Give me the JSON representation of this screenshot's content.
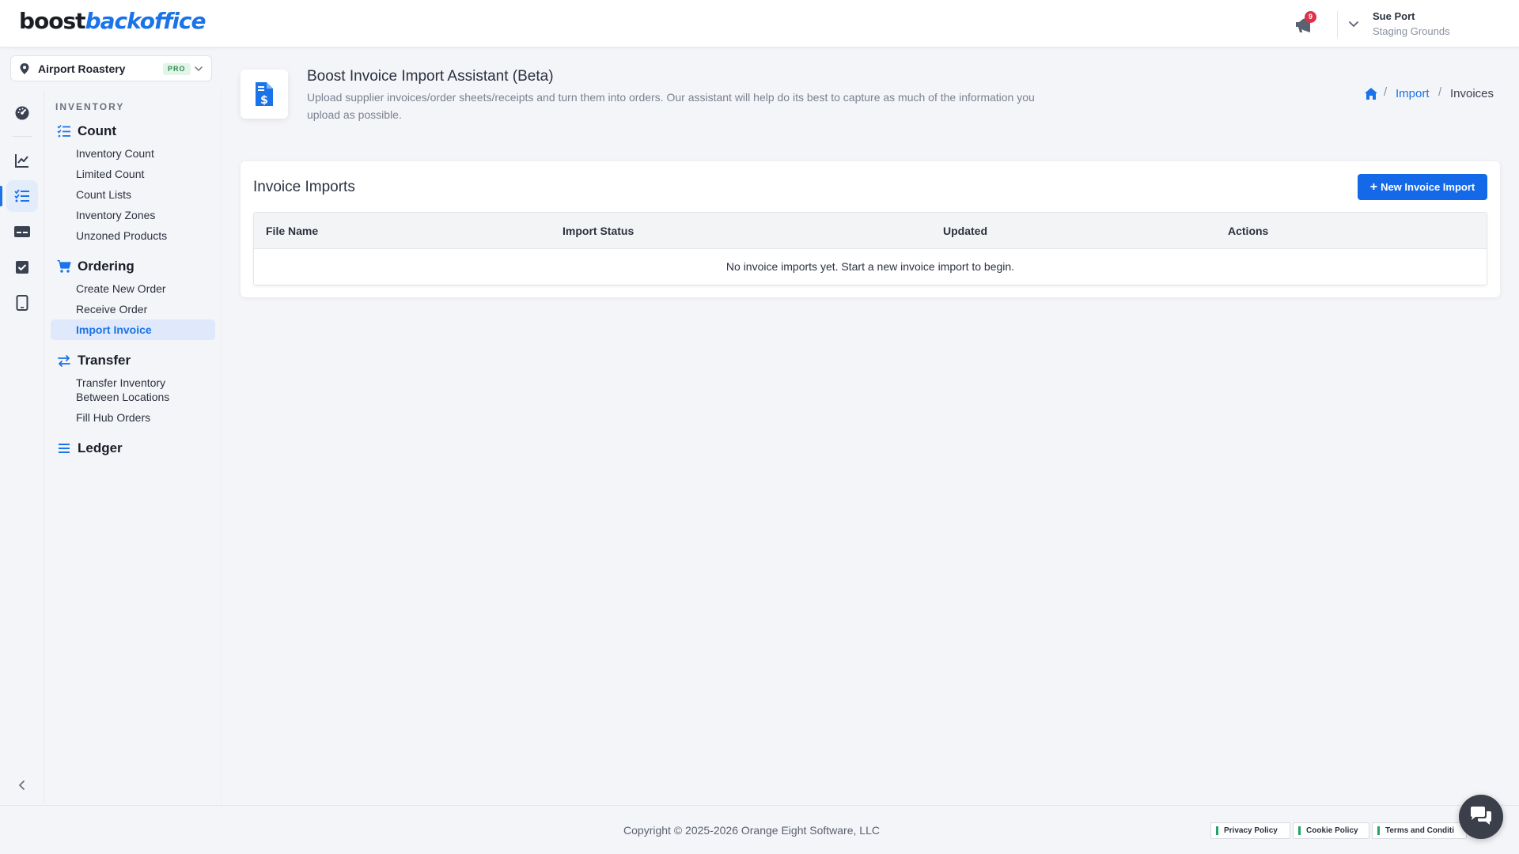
{
  "brand": {
    "part1": "boost",
    "part2": "backoffice"
  },
  "header": {
    "notification_count": "9",
    "user_name": "Sue Port",
    "user_subtitle": "Staging Grounds"
  },
  "location": {
    "name": "Airport Roastery",
    "badge": "PRO"
  },
  "rail": {
    "icons": [
      "dashboard-icon",
      "chart-icon",
      "checklist-icon",
      "card-icon",
      "checkbox-icon",
      "tablet-icon"
    ],
    "active": "checklist-icon"
  },
  "menu": {
    "heading": "INVENTORY",
    "groups": [
      {
        "label": "Count",
        "icon": "checklist-icon",
        "items": [
          "Inventory Count",
          "Limited Count",
          "Count Lists",
          "Inventory Zones",
          "Unzoned Products"
        ]
      },
      {
        "label": "Ordering",
        "icon": "cart-icon",
        "items": [
          "Create New Order",
          "Receive Order",
          "Import Invoice"
        ]
      },
      {
        "label": "Transfer",
        "icon": "transfer-icon",
        "items": [
          "Transfer Inventory Between Locations",
          "Fill Hub Orders"
        ]
      },
      {
        "label": "Ledger",
        "icon": "list-icon",
        "items": []
      }
    ],
    "active_item": "Import Invoice"
  },
  "page": {
    "title": "Boost Invoice Import Assistant (Beta)",
    "description": "Upload supplier invoices/order sheets/receipts and turn them into orders. Our assistant will help do its best to capture as much of the information you upload as possible."
  },
  "breadcrumb": {
    "import": "Import",
    "current": "Invoices"
  },
  "card": {
    "title": "Invoice Imports",
    "new_button": "New Invoice Import",
    "columns": [
      "File Name",
      "Import Status",
      "Updated",
      "Actions"
    ],
    "empty_text": "No invoice imports yet. Start a new invoice import to begin."
  },
  "footer": {
    "copyright": "Copyright © 2025-2026 Orange Eight Software, LLC",
    "links": [
      "Privacy Policy",
      "Cookie Policy",
      "Terms and Conditi"
    ]
  },
  "colors": {
    "accent": "#1a73e8",
    "button": "#1469e8",
    "badge": "#e0314b"
  }
}
